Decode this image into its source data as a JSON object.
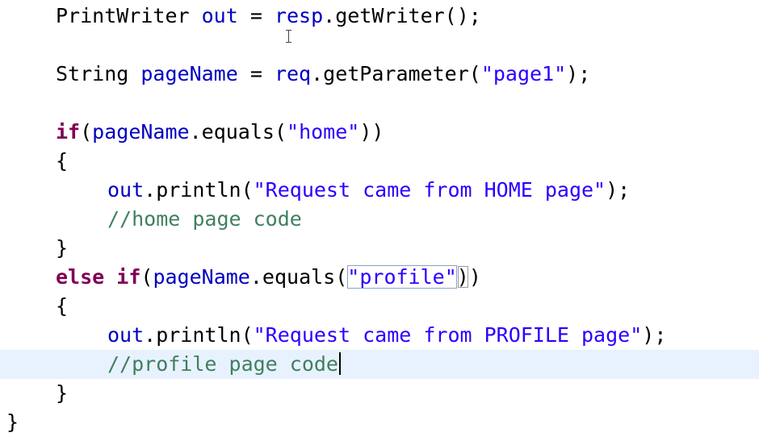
{
  "editor": {
    "lines": [
      {
        "indent": 1,
        "tokens": [
          {
            "t": "PrintWriter ",
            "c": "plain"
          },
          {
            "t": "out",
            "c": "fld"
          },
          {
            "t": " = ",
            "c": "plain"
          },
          {
            "t": "resp",
            "c": "fld"
          },
          {
            "t": ".getWriter();",
            "c": "plain"
          }
        ]
      },
      {
        "indent": 0,
        "tokens": []
      },
      {
        "indent": 1,
        "tokens": [
          {
            "t": "String ",
            "c": "plain"
          },
          {
            "t": "pageName",
            "c": "fld"
          },
          {
            "t": " = ",
            "c": "plain"
          },
          {
            "t": "req",
            "c": "fld"
          },
          {
            "t": ".getParameter(",
            "c": "plain"
          },
          {
            "t": "\"page1\"",
            "c": "str"
          },
          {
            "t": ");",
            "c": "plain"
          }
        ]
      },
      {
        "indent": 0,
        "tokens": []
      },
      {
        "indent": 1,
        "tokens": [
          {
            "t": "if",
            "c": "kw"
          },
          {
            "t": "(",
            "c": "plain"
          },
          {
            "t": "pageName",
            "c": "fld"
          },
          {
            "t": ".equals(",
            "c": "plain"
          },
          {
            "t": "\"home\"",
            "c": "str"
          },
          {
            "t": "))",
            "c": "plain"
          }
        ]
      },
      {
        "indent": 1,
        "tokens": [
          {
            "t": "{",
            "c": "plain"
          }
        ]
      },
      {
        "indent": 2,
        "tokens": [
          {
            "t": "out",
            "c": "fld"
          },
          {
            "t": ".println(",
            "c": "plain"
          },
          {
            "t": "\"Request came from HOME page\"",
            "c": "str"
          },
          {
            "t": ");",
            "c": "plain"
          }
        ]
      },
      {
        "indent": 2,
        "tokens": [
          {
            "t": "//home page code",
            "c": "cmt"
          }
        ]
      },
      {
        "indent": 1,
        "tokens": [
          {
            "t": "}",
            "c": "plain"
          }
        ]
      },
      {
        "indent": 1,
        "tokens": [
          {
            "t": "else",
            "c": "kw"
          },
          {
            "t": " ",
            "c": "plain"
          },
          {
            "t": "if",
            "c": "kw"
          },
          {
            "t": "(",
            "c": "plain"
          },
          {
            "t": "pageName",
            "c": "fld"
          },
          {
            "t": ".equals(",
            "c": "plain"
          },
          {
            "t": "\"profile\"",
            "c": "str",
            "boxed": true
          },
          {
            "t": ")",
            "c": "plain",
            "match": true
          },
          {
            "t": ")",
            "c": "plain"
          }
        ]
      },
      {
        "indent": 1,
        "tokens": [
          {
            "t": "{",
            "c": "plain"
          }
        ]
      },
      {
        "indent": 2,
        "tokens": [
          {
            "t": "out",
            "c": "fld"
          },
          {
            "t": ".println(",
            "c": "plain"
          },
          {
            "t": "\"Request came from PROFILE page\"",
            "c": "str"
          },
          {
            "t": ");",
            "c": "plain"
          }
        ]
      },
      {
        "indent": 2,
        "current": true,
        "caret": true,
        "tokens": [
          {
            "t": "//profile page code",
            "c": "cmt"
          }
        ]
      },
      {
        "indent": 1,
        "tokens": [
          {
            "t": "}",
            "c": "plain"
          }
        ]
      },
      {
        "indent": 0,
        "tokens": [
          {
            "t": "}",
            "c": "plain"
          }
        ]
      }
    ]
  }
}
